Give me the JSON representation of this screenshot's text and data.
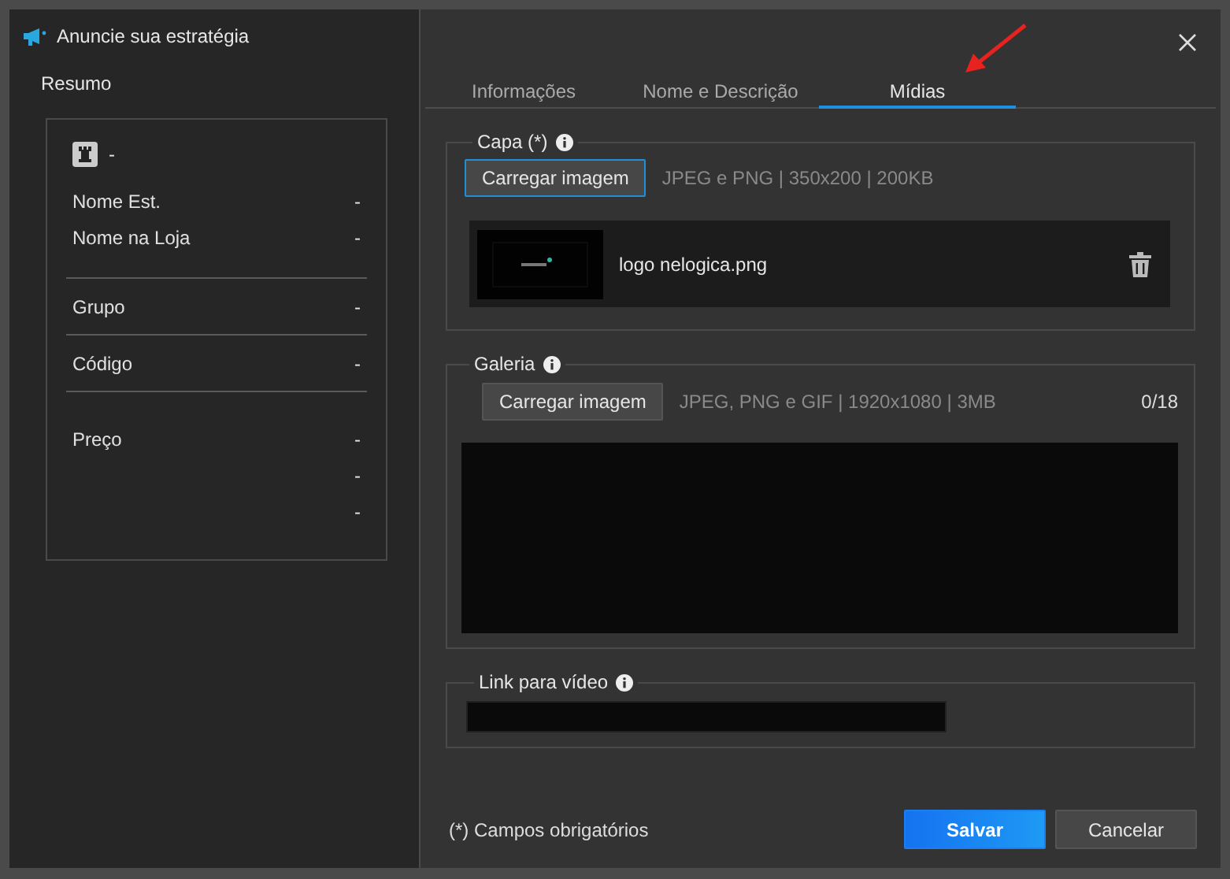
{
  "window": {
    "title": "Anuncie sua estratégia"
  },
  "summary": {
    "title": "Resumo",
    "header_value": "-",
    "sections": [
      [
        {
          "label": "Nome Est.",
          "value": "-"
        },
        {
          "label": "Nome na Loja",
          "value": "-"
        }
      ],
      [
        {
          "label": "Grupo",
          "value": "-"
        }
      ],
      [
        {
          "label": "Código",
          "value": "-"
        }
      ],
      [
        {
          "label": "Preço",
          "value": "-"
        },
        {
          "value": "-"
        },
        {
          "value": "-"
        }
      ]
    ]
  },
  "tabs": [
    {
      "label": "Informações",
      "selected": false
    },
    {
      "label": "Nome e Descrição",
      "selected": false
    },
    {
      "label": "Mídias",
      "selected": true
    }
  ],
  "cover": {
    "legend": "Capa (*)",
    "button": {
      "label": "Carregar imagem",
      "focused": true
    },
    "hint": "JPEG e PNG | 350x200 | 200KB",
    "file": {
      "name": "logo nelogica.png"
    }
  },
  "gallery": {
    "legend": "Galeria",
    "button": {
      "label": "Carregar imagem",
      "focused": false
    },
    "hint": "JPEG, PNG e GIF | 1920x1080 | 3MB",
    "count": "0/18"
  },
  "video": {
    "legend": "Link para vídeo"
  },
  "footer": {
    "note": "(*) Campos obrigatórios",
    "buttons": [
      {
        "label": "Salvar",
        "kind": "primary"
      },
      {
        "label": "Cancelar",
        "kind": "secondary"
      }
    ]
  }
}
